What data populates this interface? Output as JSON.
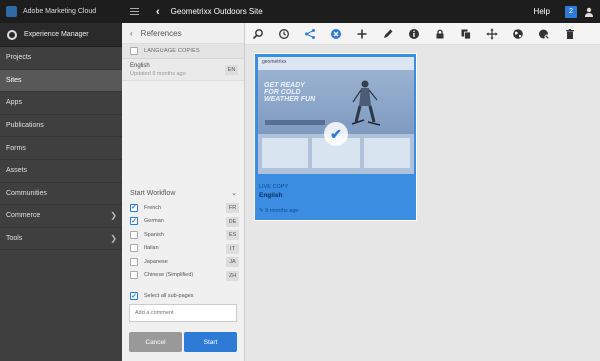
{
  "nav": {
    "brand": "Adobe Marketing Cloud",
    "section": "Experience Manager",
    "items": [
      {
        "label": "Projects",
        "chevron": false
      },
      {
        "label": "Sites",
        "chevron": false
      },
      {
        "label": "Apps",
        "chevron": false
      },
      {
        "label": "Publications",
        "chevron": false
      },
      {
        "label": "Forms",
        "chevron": false
      },
      {
        "label": "Assets",
        "chevron": false
      },
      {
        "label": "Communities",
        "chevron": false
      },
      {
        "label": "Commerce",
        "chevron": true
      },
      {
        "label": "Tools",
        "chevron": true
      }
    ],
    "active_item": "Sites"
  },
  "topbar": {
    "title": "Geometrixx Outdoors Site",
    "help": "Help",
    "badge": "2"
  },
  "references": {
    "title": "References",
    "category": "LANGUAGE COPIES",
    "item_name": "English",
    "item_updated": "Updated 9 months ago",
    "item_code": "EN"
  },
  "workflow": {
    "title": "Start Workflow",
    "languages": [
      {
        "label": "French",
        "code": "FR",
        "checked": true
      },
      {
        "label": "German",
        "code": "DE",
        "checked": true
      },
      {
        "label": "Spanish",
        "code": "ES",
        "checked": false
      },
      {
        "label": "Italian",
        "code": "IT",
        "checked": false
      },
      {
        "label": "Japanese",
        "code": "JA",
        "checked": false
      },
      {
        "label": "Chinese (Simplified)",
        "code": "ZH",
        "checked": false
      }
    ],
    "select_all_label": "Select all sub-pages",
    "comment_placeholder": "Add a comment",
    "cancel_label": "Cancel",
    "start_label": "Start"
  },
  "toolbar": {
    "icons": [
      "search-icon",
      "clock-icon",
      "share-icon",
      "close-circle-icon",
      "add-icon",
      "edit-icon",
      "info-icon",
      "lock-icon",
      "copy-icon",
      "move-icon",
      "globe-icon",
      "globe-off-icon",
      "trash-icon"
    ]
  },
  "card": {
    "thumb_logo": "geometrixx",
    "hero_text": [
      "GET READY",
      "FOR COLD",
      "WEATHER FUN"
    ],
    "tag": "LIVE COPY",
    "title": "English",
    "modified": "9 months ago"
  },
  "colors": {
    "accent": "#2d7bd6",
    "nav_bg": "#3f3f3f",
    "topbar_bg": "#1d1d1d",
    "card_bg": "#3a8de0"
  }
}
